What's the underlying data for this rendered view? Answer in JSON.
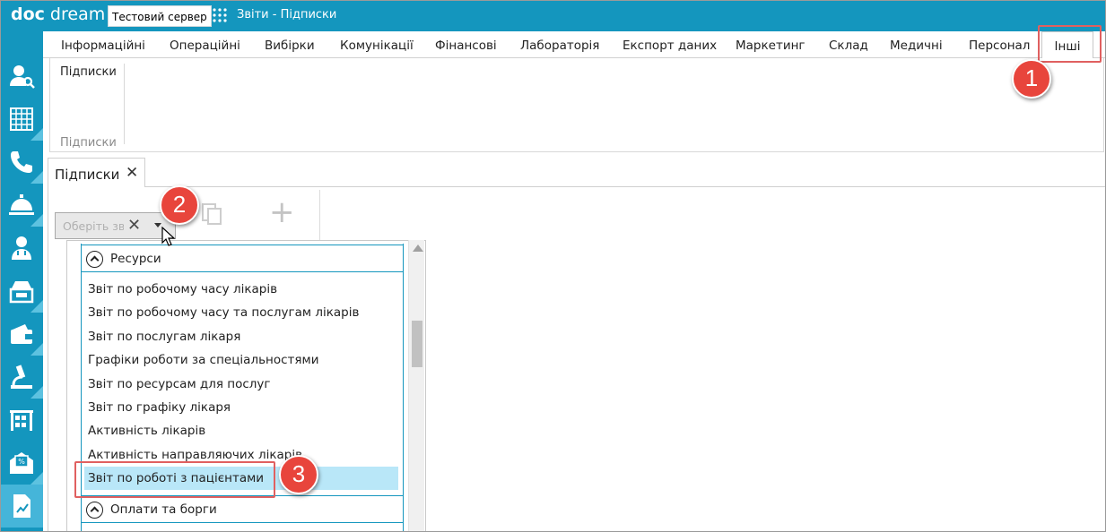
{
  "header": {
    "logo_part1": "doc",
    "logo_part2": "dream",
    "server_label": "Тестовий сервер",
    "app_title": "Звіти - Підписки"
  },
  "sidebar": {
    "items": [
      {
        "icon": "user-search-icon"
      },
      {
        "icon": "grid-table-icon"
      },
      {
        "icon": "phone-icon"
      },
      {
        "icon": "reception-bell-icon"
      },
      {
        "icon": "doctor-icon"
      },
      {
        "icon": "cash-register-icon"
      },
      {
        "icon": "wallet-icon"
      },
      {
        "icon": "microscope-icon"
      },
      {
        "icon": "warehouse-icon"
      },
      {
        "icon": "discount-envelope-icon"
      },
      {
        "icon": "report-chart-icon",
        "active": true
      }
    ]
  },
  "ribbon": {
    "tabs": [
      "Інформаційні",
      "Операційні",
      "Вибірки",
      "Комунікації",
      "Фінансові",
      "Лабораторія",
      "Експорт даних",
      "Маркетинг",
      "Склад",
      "Медичні",
      "Персонал"
    ],
    "active_tab": "Інші",
    "button_label": "Підписки",
    "group_label": "Підписки"
  },
  "document": {
    "tab_label": "Підписки",
    "tab_close": "✕"
  },
  "toolbar": {
    "combo_placeholder": "Оберіть звіт",
    "combo_clear": "✕",
    "add_label": "+"
  },
  "dropdown": {
    "group1": "Ресурси",
    "items": [
      "Звіт по робочому часу лікарів",
      "Звіт по робочому часу та послугам лікарів",
      "Звіт по послугам лікаря",
      "Графіки роботи за спеціальностями",
      "Звіт по ресурсам для послуг",
      "Звіт по графіку лікаря",
      "Активність лікарів",
      "Активність направляючих лікарів",
      "Звіт по роботі з пацієнтами"
    ],
    "selected_index": 8,
    "group2": "Оплати та борги"
  },
  "callouts": {
    "one": "1",
    "two": "2",
    "three": "3"
  },
  "colors": {
    "brand": "#1496be",
    "selection": "#b9e7f8",
    "callout": "#e8453c"
  }
}
